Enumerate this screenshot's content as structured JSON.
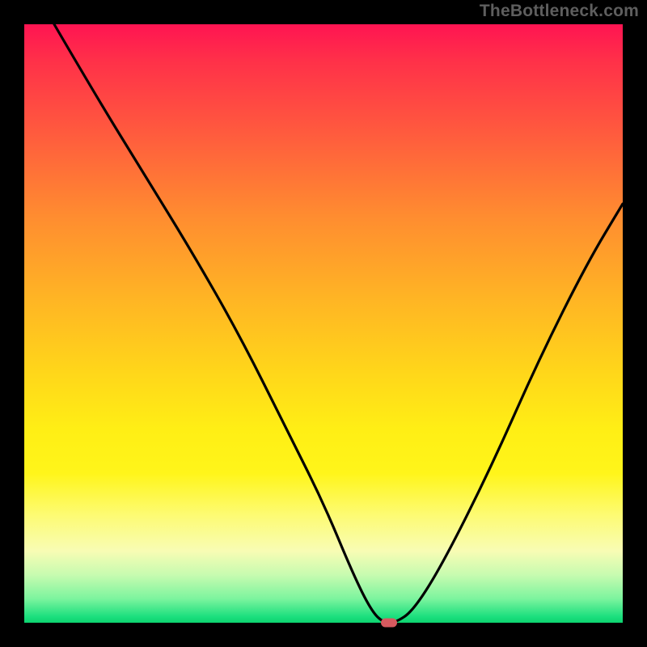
{
  "watermark": "TheBottleneck.com",
  "chart_data": {
    "type": "line",
    "title": "",
    "xlabel": "",
    "ylabel": "",
    "xlim": [
      0,
      100
    ],
    "ylim": [
      0,
      100
    ],
    "series": [
      {
        "name": "bottleneck-curve",
        "x": [
          5,
          12,
          20,
          28,
          36,
          44,
          50,
          55,
          58,
          60,
          62,
          65,
          70,
          78,
          86,
          94,
          100
        ],
        "values": [
          100,
          88,
          75,
          62,
          48,
          32,
          20,
          8,
          2,
          0,
          0,
          2,
          10,
          26,
          44,
          60,
          70
        ]
      }
    ],
    "annotations": [
      {
        "name": "optimal-point",
        "x": 61,
        "y": 0
      }
    ],
    "grid": false,
    "legend": false
  },
  "colors": {
    "curve": "#000000",
    "marker": "#d65a5f",
    "background_frame": "#000000"
  }
}
